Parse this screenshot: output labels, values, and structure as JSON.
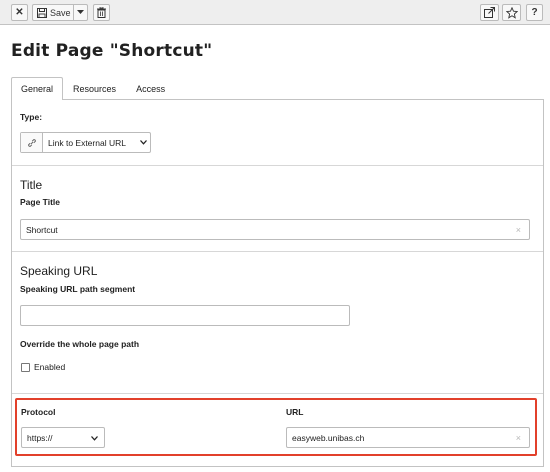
{
  "toolbar": {
    "close_icon": "close-icon",
    "save_label": "Save",
    "save_icon": "floppy-disk-icon",
    "save_dropdown_icon": "caret-down-icon",
    "delete_icon": "trash-icon",
    "open_icon": "external-link-icon",
    "bookmark_icon": "star-icon",
    "help_label": "?"
  },
  "page": {
    "title": "Edit Page \"Shortcut\""
  },
  "tabs": [
    {
      "label": "General",
      "active": true
    },
    {
      "label": "Resources",
      "active": false
    },
    {
      "label": "Access",
      "active": false
    }
  ],
  "type_section": {
    "label": "Type:",
    "icon": "link-icon",
    "value": "Link to External URL"
  },
  "title_section": {
    "heading": "Title",
    "field_label": "Page Title",
    "field_value": "Shortcut",
    "clear_label": "×"
  },
  "speaking_url_section": {
    "heading": "Speaking URL",
    "field_label": "Speaking URL path segment",
    "field_value": "",
    "override_label": "Override the whole page path",
    "checkbox_label": "Enabled",
    "checkbox_checked": false
  },
  "url_section": {
    "protocol_label": "Protocol",
    "protocol_value": "https://",
    "url_label": "URL",
    "url_value": "easyweb.unibas.ch",
    "clear_label": "×"
  },
  "colors": {
    "highlight": "#e2402b",
    "toolbar_bg": "#eeeeee",
    "border": "#c3c3c3"
  }
}
